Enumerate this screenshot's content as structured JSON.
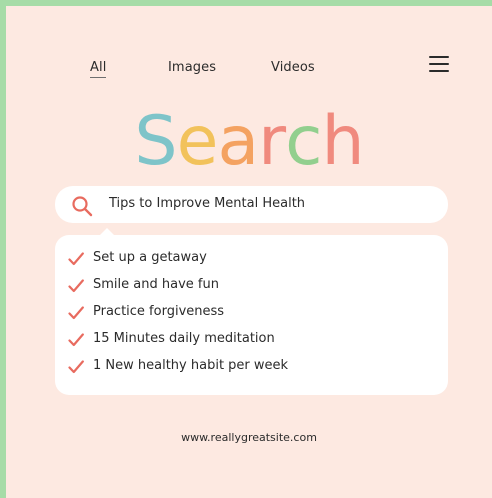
{
  "nav": {
    "tabs": [
      {
        "label": "All",
        "active": true
      },
      {
        "label": "Images",
        "active": false
      },
      {
        "label": "Videos",
        "active": false
      }
    ],
    "menu_icon": "hamburger-menu-icon"
  },
  "logo": {
    "letters": [
      {
        "char": "S",
        "color": "#7ec4c9"
      },
      {
        "char": "e",
        "color": "#f2c25b"
      },
      {
        "char": "a",
        "color": "#f4a261"
      },
      {
        "char": "r",
        "color": "#f08a7e"
      },
      {
        "char": "c",
        "color": "#92cf8e"
      },
      {
        "char": "h",
        "color": "#f08a7e"
      }
    ]
  },
  "search": {
    "icon": "search-icon",
    "value": "Tips to Improve Mental Health"
  },
  "results": {
    "check_icon": "checkmark-icon",
    "check_color": "#e86b5f",
    "items": [
      {
        "label": "Set up a getaway"
      },
      {
        "label": "Smile and have fun"
      },
      {
        "label": "Practice forgiveness"
      },
      {
        "label": "15 Minutes daily meditation"
      },
      {
        "label": "1 New healthy habit per week"
      }
    ]
  },
  "footer": {
    "url": "www.reallygreatsite.com"
  }
}
